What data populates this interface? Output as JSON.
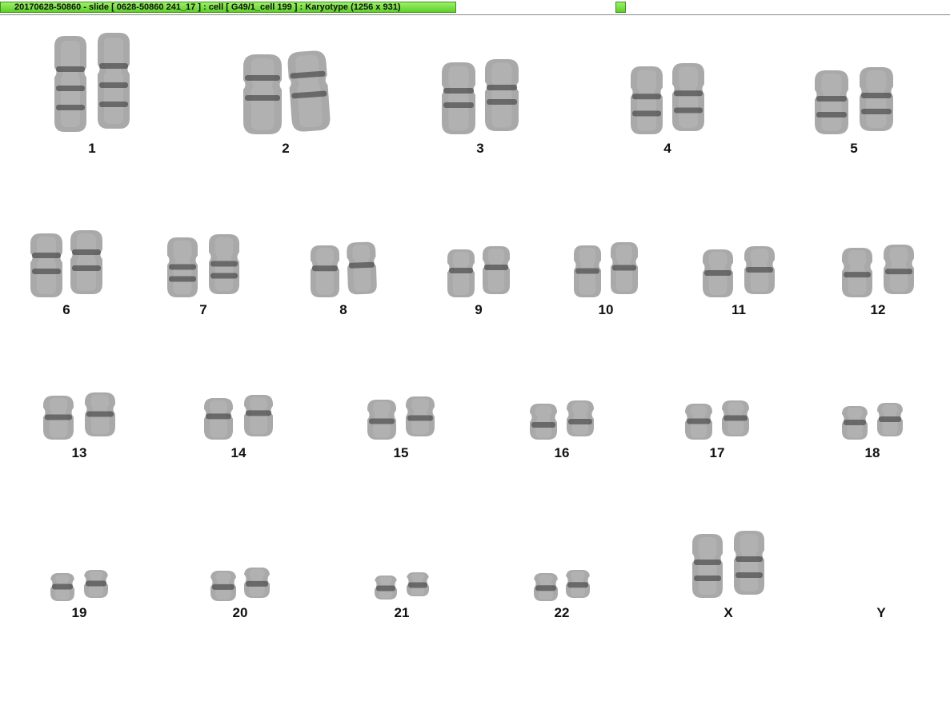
{
  "window": {
    "title": "20170628-50860 - slide [ 0628-50860 241_17 ] : cell [ G49/1_cell 199 ] : Karyotype  (1256 x 931)"
  },
  "karyotype": {
    "labels": [
      "1",
      "2",
      "3",
      "4",
      "5",
      "6",
      "7",
      "8",
      "9",
      "10",
      "11",
      "12",
      "13",
      "14",
      "15",
      "16",
      "17",
      "18",
      "19",
      "20",
      "21",
      "22",
      "X",
      "Y"
    ]
  }
}
